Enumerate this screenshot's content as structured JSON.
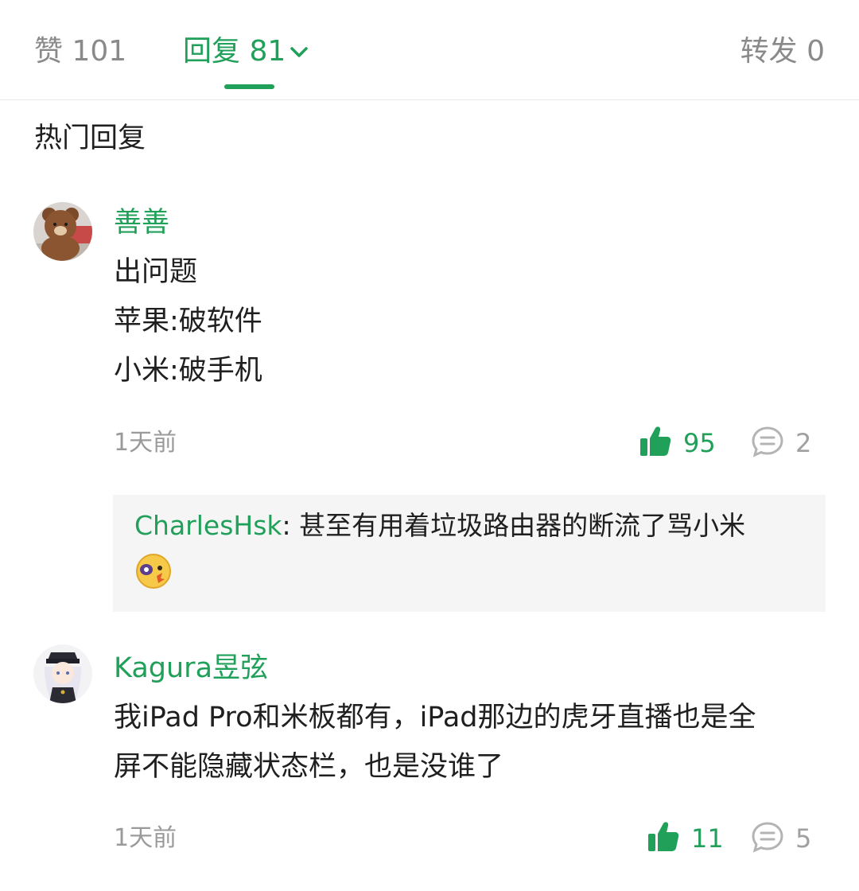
{
  "tabs": {
    "likes": "赞 101",
    "replies": "回复 81",
    "forwards": "转发 0"
  },
  "section_title": "热门回复",
  "comments": [
    {
      "username": "善善",
      "lines": [
        "出问题",
        "苹果:破软件",
        "小米:破手机"
      ],
      "time": "1天前",
      "likes": "95",
      "replies": "2",
      "sub_reply": {
        "user": "CharlesHsk",
        "text": ": 甚至有用着垃圾路由器的断流了骂小米"
      }
    },
    {
      "username": "Kagura昱弦",
      "lines": [
        "我iPad Pro和米板都有，iPad那边的虎牙直播也是全",
        "屏不能隐藏状态栏，也是没谁了"
      ],
      "time": "1天前",
      "likes": "11",
      "replies": "5"
    }
  ],
  "colors": {
    "accent": "#21a05a",
    "muted": "#9a9a9a",
    "subreply_bg": "#f5f5f5"
  },
  "icons": [
    "chevron-down-icon",
    "thumbs-up-icon",
    "comment-icon",
    "emoji-icon"
  ]
}
